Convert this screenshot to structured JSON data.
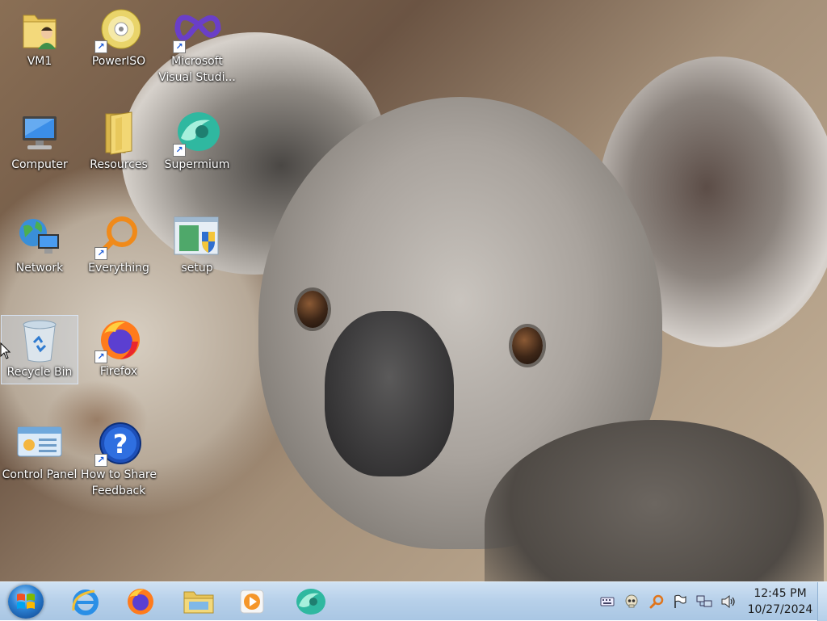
{
  "desktop": {
    "icons": [
      {
        "id": "vm1",
        "label": "VM1",
        "icon": "user-folder-icon",
        "shortcut": false
      },
      {
        "id": "poweriso",
        "label": "PowerISO",
        "icon": "disc-icon",
        "shortcut": true
      },
      {
        "id": "visual-studio",
        "label_line1": "Microsoft",
        "label_line2": "Visual Studi...",
        "icon": "visual-studio-icon",
        "shortcut": true
      },
      {
        "id": "computer",
        "label": "Computer",
        "icon": "computer-icon",
        "shortcut": false
      },
      {
        "id": "resources",
        "label": "Resources",
        "icon": "folder-icon",
        "shortcut": false
      },
      {
        "id": "supermium",
        "label": "Supermium",
        "icon": "supermium-icon",
        "shortcut": true
      },
      {
        "id": "network",
        "label": "Network",
        "icon": "network-icon",
        "shortcut": false
      },
      {
        "id": "everything",
        "label": "Everything",
        "icon": "search-magnifier-icon",
        "shortcut": true
      },
      {
        "id": "setup",
        "label": "setup",
        "icon": "setup-installer-icon",
        "shortcut": false
      },
      {
        "id": "recycle-bin",
        "label": "Recycle Bin",
        "icon": "recycle-bin-icon",
        "shortcut": false,
        "selected": true
      },
      {
        "id": "firefox",
        "label": "Firefox",
        "icon": "firefox-icon",
        "shortcut": true
      },
      {
        "id": "control-panel",
        "label": "Control Panel",
        "icon": "control-panel-icon",
        "shortcut": false
      },
      {
        "id": "feedback",
        "label_line1": "How to Share",
        "label_line2": "Feedback",
        "icon": "help-question-icon",
        "shortcut": true
      }
    ]
  },
  "taskbar": {
    "pinned": [
      {
        "name": "Internet Explorer",
        "icon": "internet-explorer-icon"
      },
      {
        "name": "Firefox",
        "icon": "firefox-icon"
      },
      {
        "name": "Windows Explorer",
        "icon": "file-explorer-icon"
      },
      {
        "name": "Media Player",
        "icon": "media-player-icon"
      },
      {
        "name": "Supermium",
        "icon": "supermium-icon"
      }
    ],
    "tray": [
      {
        "name": "keyboard",
        "icon": "keyboard-icon"
      },
      {
        "name": "app",
        "icon": "skull-icon"
      },
      {
        "name": "everything",
        "icon": "search-magnifier-icon"
      },
      {
        "name": "action-center",
        "icon": "flag-icon"
      },
      {
        "name": "network",
        "icon": "network-tray-icon"
      },
      {
        "name": "volume",
        "icon": "speaker-icon"
      }
    ],
    "clock": {
      "time": "12:45 PM",
      "date": "10/27/2024"
    }
  },
  "colors": {
    "taskbar_top": "#cfe1f3",
    "taskbar_bottom": "#a9c6e3",
    "selection": "#d2e1f5"
  }
}
